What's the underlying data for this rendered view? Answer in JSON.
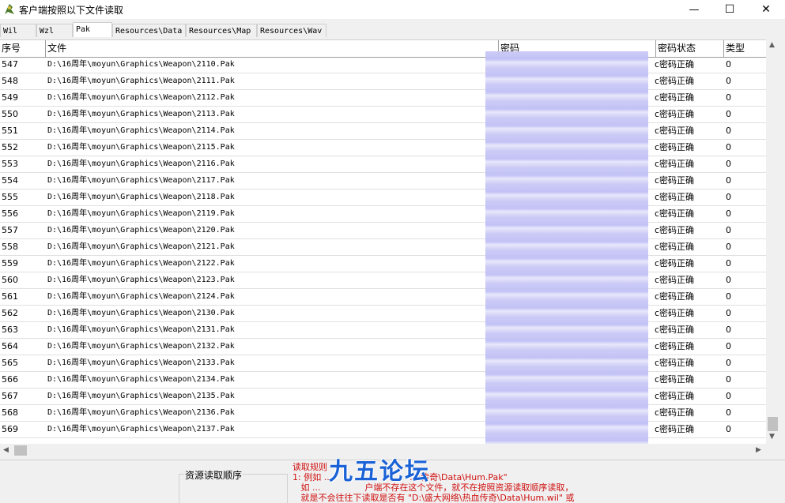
{
  "window": {
    "title": "客户端按照以下文件读取",
    "minimize_glyph": "—",
    "maximize_glyph": "☐",
    "close_glyph": "✕"
  },
  "tabs": [
    "Wil",
    "Wzl",
    "Pak",
    "Resources\\Data",
    "Resources\\Map",
    "Resources\\Wav"
  ],
  "active_tab": "Pak",
  "table": {
    "columns": [
      "序号",
      "文件",
      "密码",
      "密码状态",
      "类型"
    ],
    "rows": [
      {
        "index": "547",
        "file": "D:\\16周年\\moyun\\Graphics\\Weapon\\2110.Pak",
        "status": "c密码正确",
        "type": "0"
      },
      {
        "index": "548",
        "file": "D:\\16周年\\moyun\\Graphics\\Weapon\\2111.Pak",
        "status": "c密码正确",
        "type": "0"
      },
      {
        "index": "549",
        "file": "D:\\16周年\\moyun\\Graphics\\Weapon\\2112.Pak",
        "status": "c密码正确",
        "type": "0"
      },
      {
        "index": "550",
        "file": "D:\\16周年\\moyun\\Graphics\\Weapon\\2113.Pak",
        "status": "c密码正确",
        "type": "0"
      },
      {
        "index": "551",
        "file": "D:\\16周年\\moyun\\Graphics\\Weapon\\2114.Pak",
        "status": "c密码正确",
        "type": "0"
      },
      {
        "index": "552",
        "file": "D:\\16周年\\moyun\\Graphics\\Weapon\\2115.Pak",
        "status": "c密码正确",
        "type": "0"
      },
      {
        "index": "553",
        "file": "D:\\16周年\\moyun\\Graphics\\Weapon\\2116.Pak",
        "status": "c密码正确",
        "type": "0"
      },
      {
        "index": "554",
        "file": "D:\\16周年\\moyun\\Graphics\\Weapon\\2117.Pak",
        "status": "c密码正确",
        "type": "0"
      },
      {
        "index": "555",
        "file": "D:\\16周年\\moyun\\Graphics\\Weapon\\2118.Pak",
        "status": "c密码正确",
        "type": "0"
      },
      {
        "index": "556",
        "file": "D:\\16周年\\moyun\\Graphics\\Weapon\\2119.Pak",
        "status": "c密码正确",
        "type": "0"
      },
      {
        "index": "557",
        "file": "D:\\16周年\\moyun\\Graphics\\Weapon\\2120.Pak",
        "status": "c密码正确",
        "type": "0"
      },
      {
        "index": "558",
        "file": "D:\\16周年\\moyun\\Graphics\\Weapon\\2121.Pak",
        "status": "c密码正确",
        "type": "0"
      },
      {
        "index": "559",
        "file": "D:\\16周年\\moyun\\Graphics\\Weapon\\2122.Pak",
        "status": "c密码正确",
        "type": "0"
      },
      {
        "index": "560",
        "file": "D:\\16周年\\moyun\\Graphics\\Weapon\\2123.Pak",
        "status": "c密码正确",
        "type": "0"
      },
      {
        "index": "561",
        "file": "D:\\16周年\\moyun\\Graphics\\Weapon\\2124.Pak",
        "status": "c密码正确",
        "type": "0"
      },
      {
        "index": "562",
        "file": "D:\\16周年\\moyun\\Graphics\\Weapon\\2130.Pak",
        "status": "c密码正确",
        "type": "0"
      },
      {
        "index": "563",
        "file": "D:\\16周年\\moyun\\Graphics\\Weapon\\2131.Pak",
        "status": "c密码正确",
        "type": "0"
      },
      {
        "index": "564",
        "file": "D:\\16周年\\moyun\\Graphics\\Weapon\\2132.Pak",
        "status": "c密码正确",
        "type": "0"
      },
      {
        "index": "565",
        "file": "D:\\16周年\\moyun\\Graphics\\Weapon\\2133.Pak",
        "status": "c密码正确",
        "type": "0"
      },
      {
        "index": "566",
        "file": "D:\\16周年\\moyun\\Graphics\\Weapon\\2134.Pak",
        "status": "c密码正确",
        "type": "0"
      },
      {
        "index": "567",
        "file": "D:\\16周年\\moyun\\Graphics\\Weapon\\2135.Pak",
        "status": "c密码正确",
        "type": "0"
      },
      {
        "index": "568",
        "file": "D:\\16周年\\moyun\\Graphics\\Weapon\\2136.Pak",
        "status": "c密码正确",
        "type": "0"
      },
      {
        "index": "569",
        "file": "D:\\16周年\\moyun\\Graphics\\Weapon\\2137.Pak",
        "status": "c密码正确",
        "type": "0"
      }
    ]
  },
  "bottom": {
    "order_label": "资源读取顺序",
    "rules_text": "读取规则\n1: 例如 ...                            ...\\传奇\\Data\\Hum.Pak\"\n   如 ...                户端不存在这个文件，就不在按照资源读取顺序读取，\n   就是不会往往下读取是否有 \"D:\\盛大网络\\热血传奇\\Data\\Hum.wil\" 或",
    "watermark": "九五论坛"
  },
  "colors": {
    "rules_text": "#d01010",
    "watermark": "#1a62d6",
    "redaction": "#c9c8f5"
  }
}
